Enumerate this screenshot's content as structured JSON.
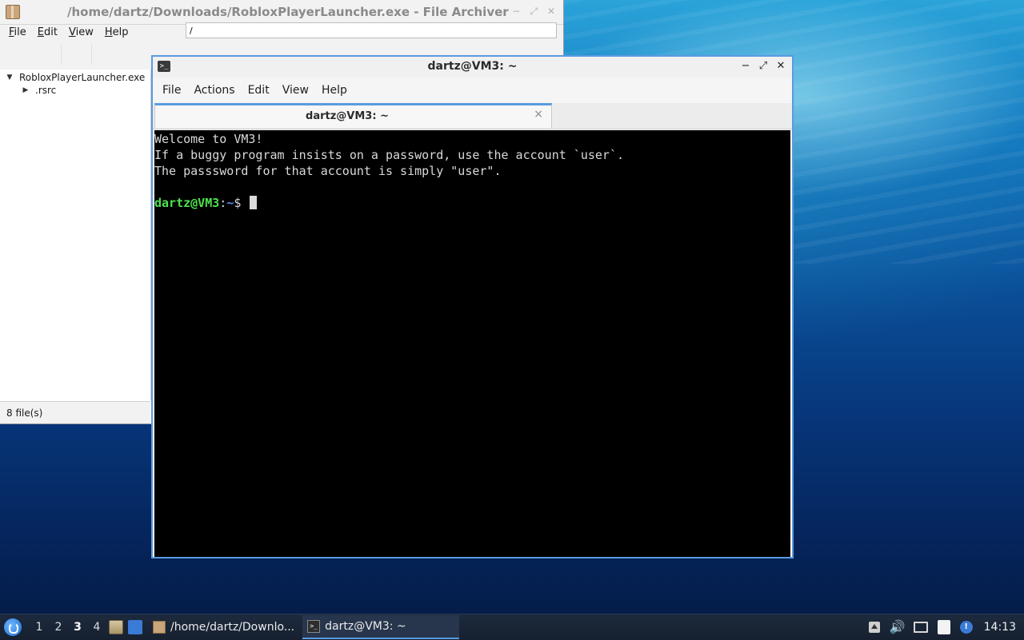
{
  "archiver": {
    "title": "/home/dartz/Downloads/RobloxPlayerLauncher.exe - File Archiver",
    "menu": [
      {
        "pre": "",
        "key": "F",
        "post": "ile"
      },
      {
        "pre": "",
        "key": "E",
        "post": "dit"
      },
      {
        "pre": "",
        "key": "V",
        "post": "iew"
      },
      {
        "pre": "",
        "key": "H",
        "post": "elp"
      }
    ],
    "path_value": "/",
    "tree": {
      "root": "RobloxPlayerLauncher.exe",
      "child": ".rsrc"
    },
    "status": "8 file(s)"
  },
  "terminal": {
    "title": "dartz@VM3: ~",
    "menu": [
      "File",
      "Actions",
      "Edit",
      "View",
      "Help"
    ],
    "tab_label": "dartz@VM3: ~",
    "tab_close": "×",
    "lines": [
      "Welcome to VM3!",
      "If a buggy program insists on a password, use the account `user`.",
      "The passsword for that account is simply \"user\"."
    ],
    "prompt": {
      "user": "dartz@VM3",
      "sep": ":",
      "path": "~",
      "symbol": "$ "
    }
  },
  "taskbar": {
    "workspaces": [
      "1",
      "2",
      "3",
      "4"
    ],
    "active_workspace": "3",
    "tasks": [
      {
        "label": "/home/dartz/Downlo...",
        "icon": "archive-icon"
      },
      {
        "label": "dartz@VM3: ~",
        "icon": "terminal-icon"
      }
    ],
    "clock": "14:13"
  },
  "colors": {
    "prompt_user": "#4de34d",
    "prompt_path": "#5b8ef0",
    "accent": "#5a9ae0"
  }
}
